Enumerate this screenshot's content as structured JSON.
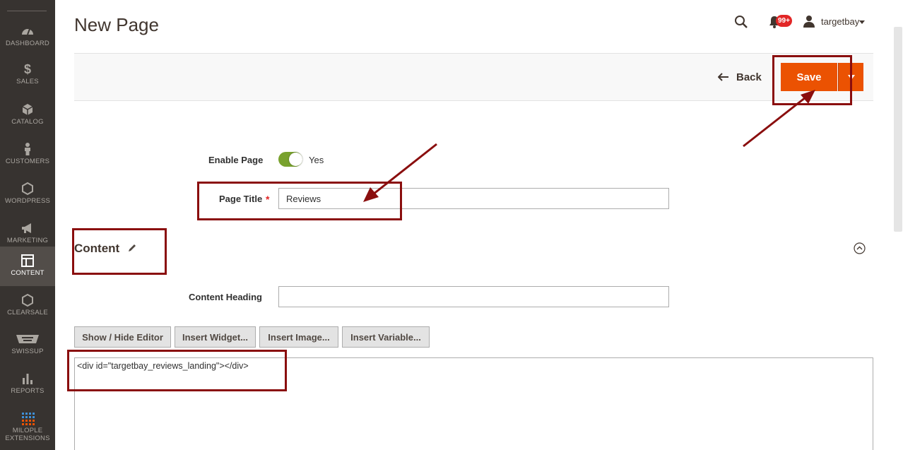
{
  "sidebar": {
    "items": [
      {
        "label": "DASHBOARD",
        "icon": "dashboard-icon"
      },
      {
        "label": "SALES",
        "icon": "dollar-icon"
      },
      {
        "label": "CATALOG",
        "icon": "cube-icon"
      },
      {
        "label": "CUSTOMERS",
        "icon": "person-icon"
      },
      {
        "label": "WORDPRESS",
        "icon": "hexagon-icon"
      },
      {
        "label": "MARKETING",
        "icon": "megaphone-icon"
      },
      {
        "label": "CONTENT",
        "icon": "layout-icon"
      },
      {
        "label": "CLEARSALE",
        "icon": "hexagon-icon"
      },
      {
        "label": "SWISSUP",
        "icon": "swissup-icon"
      },
      {
        "label": "REPORTS",
        "icon": "bar-chart-icon"
      },
      {
        "label": "MILOPLE EXTENSIONS",
        "icon": "grid-dots-icon"
      }
    ],
    "active_index": 6
  },
  "header": {
    "title": "New Page",
    "notification_count": "99+",
    "username": "targetbay"
  },
  "actions": {
    "back_label": "Back",
    "save_label": "Save"
  },
  "form": {
    "enable_label": "Enable Page",
    "enable_value": "Yes",
    "enabled": true,
    "title_label": "Page Title",
    "title_value": "Reviews",
    "content_section": "Content",
    "heading_label": "Content Heading",
    "heading_value": ""
  },
  "editor": {
    "buttons": [
      "Show / Hide Editor",
      "Insert Widget...",
      "Insert Image...",
      "Insert Variable..."
    ],
    "content": "<div id=\"targetbay_reviews_landing\"></div>"
  },
  "colors": {
    "accent": "#eb5202",
    "sidebar_bg": "#373330",
    "toggle_on": "#79a22e",
    "annotation": "#8a0e0e"
  }
}
